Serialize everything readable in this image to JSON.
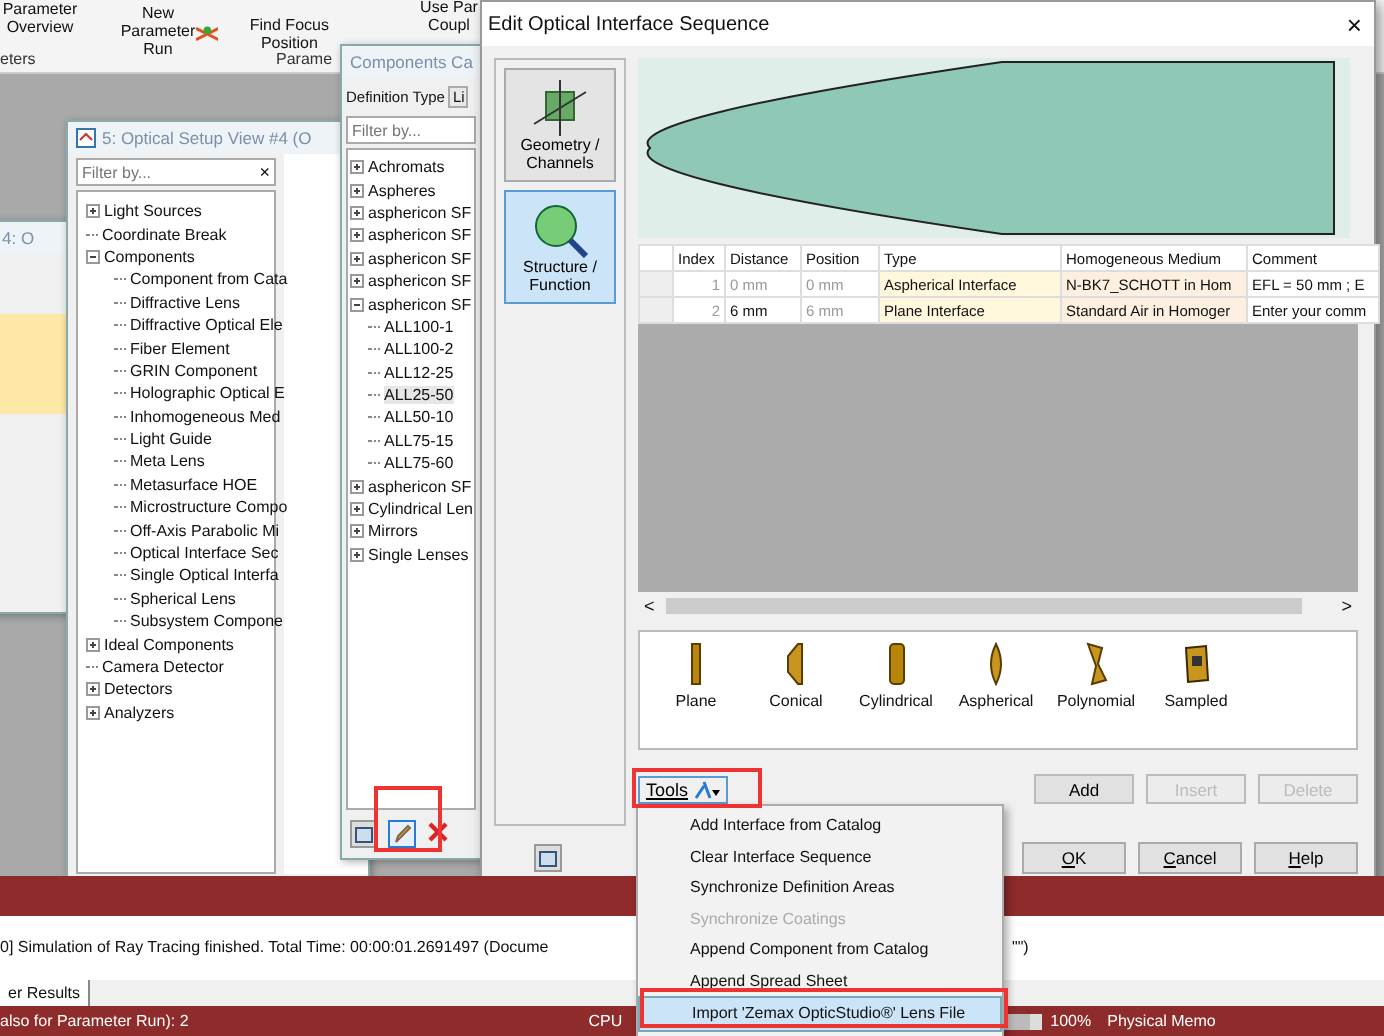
{
  "ribbon": {
    "buttons": [
      {
        "kind": "text",
        "label": "Parameter Overview"
      },
      {
        "kind": "text",
        "label": "New Parameter Run"
      },
      {
        "kind": "icon",
        "label": "Find Focus Position"
      },
      {
        "kind": "text",
        "label": "Use Par\nCoupl"
      }
    ],
    "groups": [
      "eters",
      "Parame"
    ]
  },
  "back_window": {
    "title": "4: O"
  },
  "setup_window": {
    "title": "5: Optical Setup View #4 (O",
    "filter": {
      "placeholder": "Filter by..."
    },
    "clear": "×",
    "tree": [
      {
        "label": "Light Sources",
        "expanded": false
      },
      {
        "label": "Coordinate Break"
      },
      {
        "label": "Components",
        "expanded": true,
        "children": [
          {
            "label": "Component from Cata"
          },
          {
            "label": "Diffractive Lens"
          },
          {
            "label": "Diffractive Optical Ele"
          },
          {
            "label": "Fiber Element"
          },
          {
            "label": "GRIN Component"
          },
          {
            "label": "Holographic Optical E"
          },
          {
            "label": "Inhomogeneous Med"
          },
          {
            "label": "Light Guide"
          },
          {
            "label": "Meta Lens"
          },
          {
            "label": "Metasurface HOE"
          },
          {
            "label": "Microstructure Compo"
          },
          {
            "label": "Off-Axis Parabolic Mi"
          },
          {
            "label": "Optical Interface Sec"
          },
          {
            "label": "Single Optical Interfa"
          },
          {
            "label": "Spherical Lens"
          },
          {
            "label": "Subsystem Compone"
          }
        ]
      },
      {
        "label": "Ideal Components",
        "expanded": false
      },
      {
        "label": "Camera Detector"
      },
      {
        "label": "Detectors",
        "expanded": false
      },
      {
        "label": "Analyzers",
        "expanded": false
      }
    ]
  },
  "catalog_window": {
    "title": "Components Ca",
    "definition_label": "Definition Type",
    "definition_value": "Li",
    "filter": {
      "placeholder": "Filter by..."
    },
    "tree": [
      {
        "label": "Achromats",
        "expanded": false
      },
      {
        "label": "Aspheres",
        "expanded": false
      },
      {
        "label": "asphericon SF",
        "expanded": false
      },
      {
        "label": "asphericon SF",
        "expanded": false
      },
      {
        "label": "asphericon SF",
        "expanded": false
      },
      {
        "label": "asphericon SF",
        "expanded": false
      },
      {
        "label": "asphericon SF",
        "expanded": true,
        "children": [
          {
            "label": "ALL100-1",
            "selected": false
          },
          {
            "label": "ALL100-2",
            "selected": false
          },
          {
            "label": "ALL12-25",
            "selected": false
          },
          {
            "label": "ALL25-50",
            "selected": true
          },
          {
            "label": "ALL50-10",
            "selected": false
          },
          {
            "label": "ALL75-15",
            "selected": false
          },
          {
            "label": "ALL75-60",
            "selected": false
          }
        ]
      },
      {
        "label": "asphericon SF",
        "expanded": false
      },
      {
        "label": "Cylindrical Len",
        "expanded": false
      },
      {
        "label": "Mirrors",
        "expanded": false
      },
      {
        "label": "Single Lenses",
        "expanded": false
      }
    ],
    "tools": [
      {
        "kind": "catalog"
      },
      {
        "kind": "edit"
      },
      {
        "kind": "delete"
      }
    ]
  },
  "dialog": {
    "title": "Edit Optical Interface Sequence",
    "close": "×",
    "sidebar": [
      {
        "kind": "geometry",
        "label": "Geometry / Channels",
        "selected": false
      },
      {
        "kind": "structure",
        "label": "Structure / Function",
        "selected": true
      }
    ],
    "table": {
      "columns": [
        "Index",
        "Distance",
        "Position",
        "Type",
        "Homogeneous Medium",
        "Comment"
      ],
      "rows": [
        {
          "index": "1",
          "distance": "0 mm",
          "distance_disabled": true,
          "position": "0 mm",
          "type": "Aspherical Interface",
          "medium": "N-BK7_SCHOTT in Hom",
          "comment": "EFL = 50 mm ; E"
        },
        {
          "index": "2",
          "distance": "6 mm",
          "distance_disabled": false,
          "position": "6 mm",
          "type": "Plane Interface",
          "medium": "Standard Air in Homoger",
          "comment": "Enter your comm"
        }
      ]
    },
    "scroll_left": "<",
    "scroll_right": ">",
    "palette": [
      {
        "kind": "plane",
        "label": "Plane"
      },
      {
        "kind": "conical",
        "label": "Conical"
      },
      {
        "kind": "cylindrical",
        "label": "Cylindrical"
      },
      {
        "kind": "aspherical",
        "label": "Aspherical"
      },
      {
        "kind": "polynomial",
        "label": "Polynomial"
      },
      {
        "kind": "sampled",
        "label": "Sampled"
      }
    ],
    "tools_button": "Tools",
    "actions": [
      {
        "label": "Add",
        "disabled": false
      },
      {
        "label": "Insert",
        "disabled": true
      },
      {
        "label": "Delete",
        "disabled": true
      }
    ],
    "buttons": [
      "OK",
      "Cancel",
      "Help"
    ]
  },
  "tools_menu": [
    {
      "label": "Add Interface from Catalog",
      "disabled": false,
      "selected": false
    },
    {
      "label": "Clear Interface Sequence",
      "disabled": false,
      "selected": false
    },
    {
      "label": "Synchronize Definition Areas",
      "disabled": false,
      "selected": false
    },
    {
      "label": "Synchronize Coatings",
      "disabled": true,
      "selected": false
    },
    {
      "label": "Append Component from Catalog",
      "disabled": false,
      "selected": false
    },
    {
      "label": "Append Spread Sheet",
      "disabled": false,
      "selected": false
    },
    {
      "label": "Import 'Zemax OpticStudio®' Lens File",
      "disabled": false,
      "selected": true
    }
  ],
  "messages": {
    "text": "0] Simulation of Ray Tracing finished. Total Time: 00:00:01.2691497 (Docume",
    "tail": "\"\")"
  },
  "result_tab": "er Results",
  "status_bar": {
    "left": "also for Parameter Run): 2",
    "cpu": "CPU",
    "level": 0.92,
    "percent": "100%",
    "memory": "Physical Memo"
  }
}
